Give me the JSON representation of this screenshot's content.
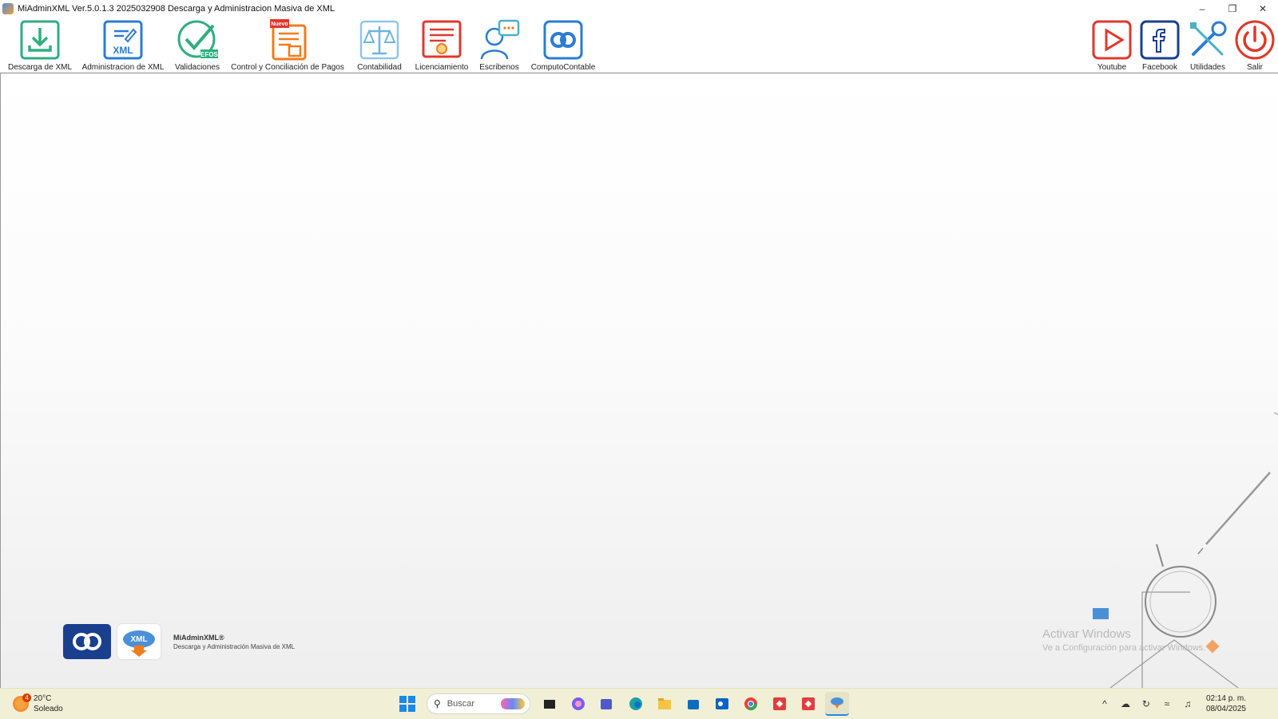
{
  "window": {
    "title": "MiAdminXML Ver.5.0.1.3 2025032908 Descarga y Administracion Masiva de XML",
    "controls": {
      "minimize": "–",
      "restore": "❐",
      "close": "✕"
    }
  },
  "toolbar": {
    "left": [
      {
        "label": "Descarga de XML",
        "icon": "download-icon"
      },
      {
        "label": "Administracion de XML",
        "icon": "xml-edit-icon",
        "glyph": "XML"
      },
      {
        "label": "Validaciones",
        "icon": "checkmark-efos-icon",
        "glyph": "EFOS"
      },
      {
        "label": "Control y Conciliación de Pagos",
        "icon": "payments-document-icon",
        "badge": "Nuevo"
      },
      {
        "label": "Contabilidad",
        "icon": "balance-scale-icon"
      },
      {
        "label": "Licenciamiento",
        "icon": "certificate-icon"
      },
      {
        "label": "Escribenos",
        "icon": "chat-user-icon"
      },
      {
        "label": "ComputoContable",
        "icon": "computo-contable-logo-icon"
      }
    ],
    "right": [
      {
        "label": "Youtube",
        "icon": "youtube-play-icon"
      },
      {
        "label": "Facebook",
        "icon": "facebook-icon"
      },
      {
        "label": "Utilidades",
        "icon": "tools-icon"
      },
      {
        "label": "Salir",
        "icon": "power-icon"
      }
    ]
  },
  "brand": {
    "name": "MiAdminXML®",
    "subtitle": "Descarga y Administración Masiva de XML",
    "logo2_glyph": "XML"
  },
  "watermark": {
    "line1": "Activar Windows",
    "line2": "Ve a Configuración para activar Windows."
  },
  "taskbar": {
    "weather": {
      "temp": "20°C",
      "condition": "Soleado",
      "badge": "4"
    },
    "search_placeholder": "Buscar",
    "clock": {
      "time": "02:14 p. m.",
      "date": "08/04/2025"
    }
  },
  "colors": {
    "green": "#2fae7e",
    "blue": "#2b7cd3",
    "orange": "#f07c1e",
    "red": "#e0382c",
    "taskbar": "#f1f0d6"
  }
}
